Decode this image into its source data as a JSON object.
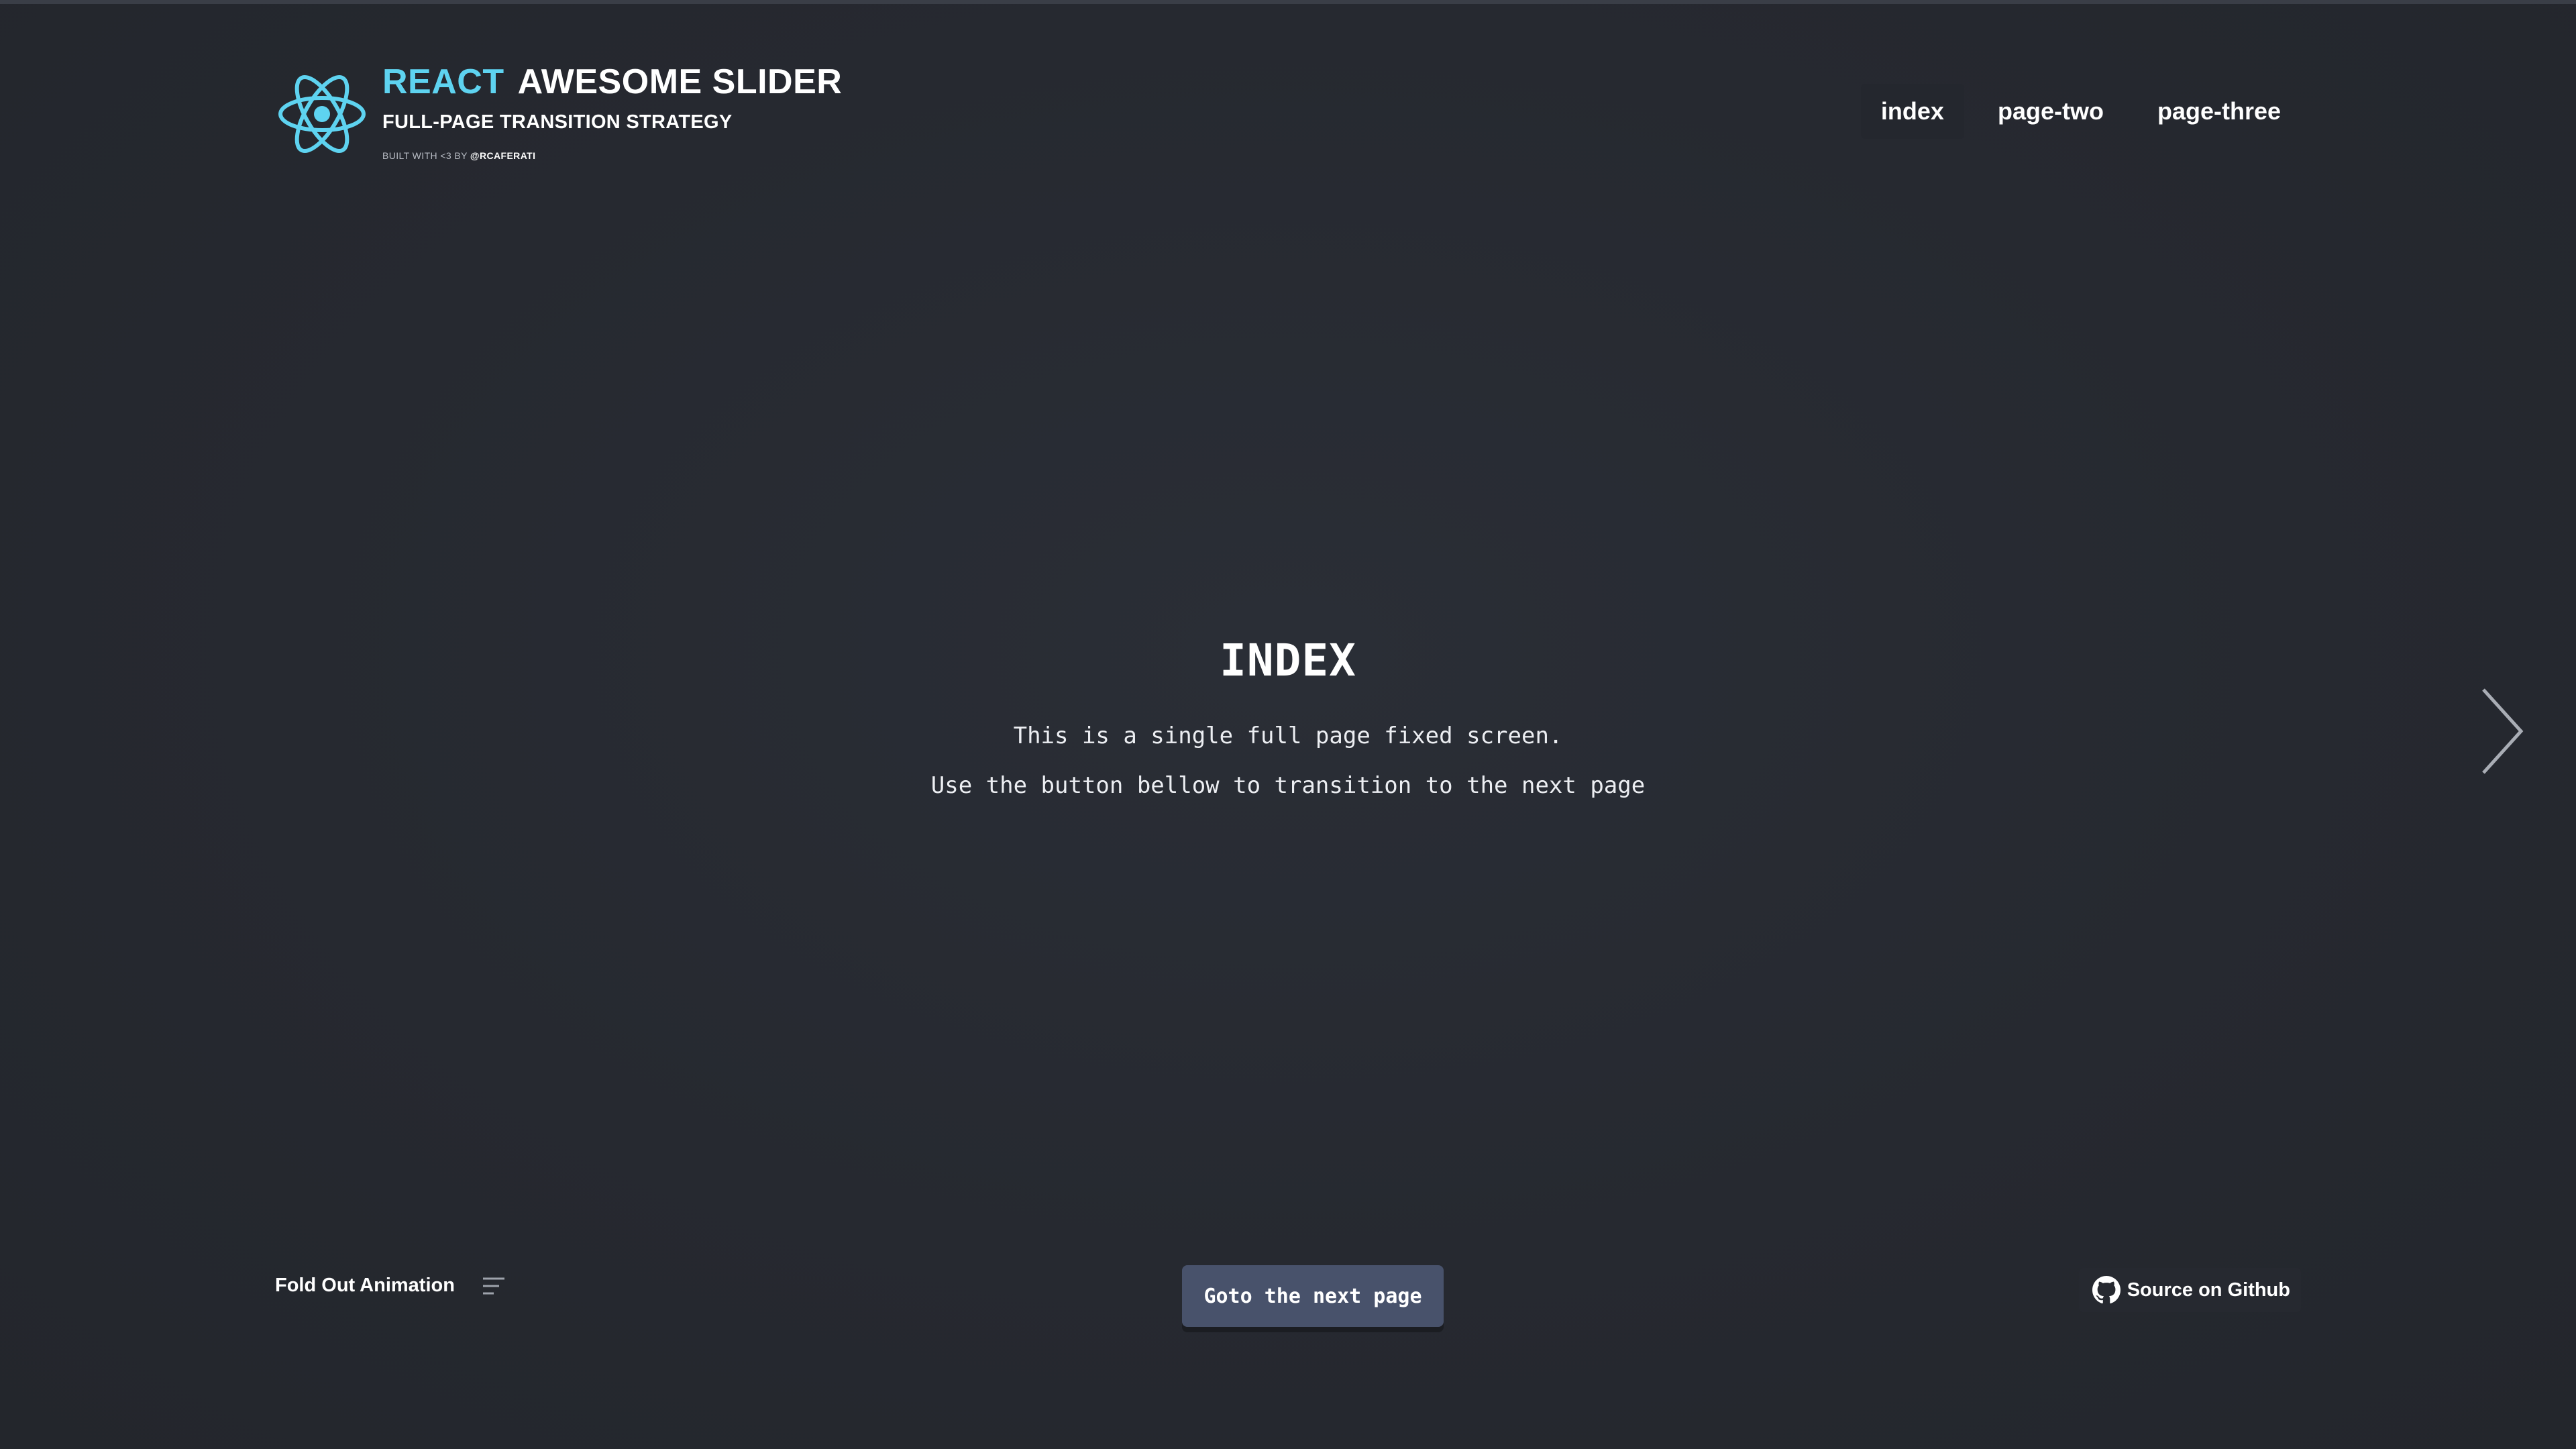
{
  "header": {
    "title_accent": "REACT",
    "title_main": "AWESOME SLIDER",
    "subtitle": "FULL-PAGE TRANSITION STRATEGY",
    "credit_prefix": "BUILT WITH <3 BY ",
    "credit_handle": "@RCAFERATI",
    "logo_icon": "react-atom-icon"
  },
  "nav": {
    "items": [
      {
        "label": "index",
        "active": true
      },
      {
        "label": "page-two",
        "active": false
      },
      {
        "label": "page-three",
        "active": false
      }
    ]
  },
  "main": {
    "heading": "INDEX",
    "line1": "This is a single full page fixed screen.",
    "line2": "Use the button bellow to transition to the next page"
  },
  "controls": {
    "next_arrow_icon": "chevron-right-icon",
    "animation_label": "Fold Out Animation",
    "animation_menu_icon": "menu-lines-icon",
    "goto_button_label": "Goto the next page",
    "github_label": "Source on Github",
    "github_icon": "github-icon"
  },
  "colors": {
    "background": "#262930",
    "accent": "#5ed3f0",
    "button": "#48526b"
  }
}
